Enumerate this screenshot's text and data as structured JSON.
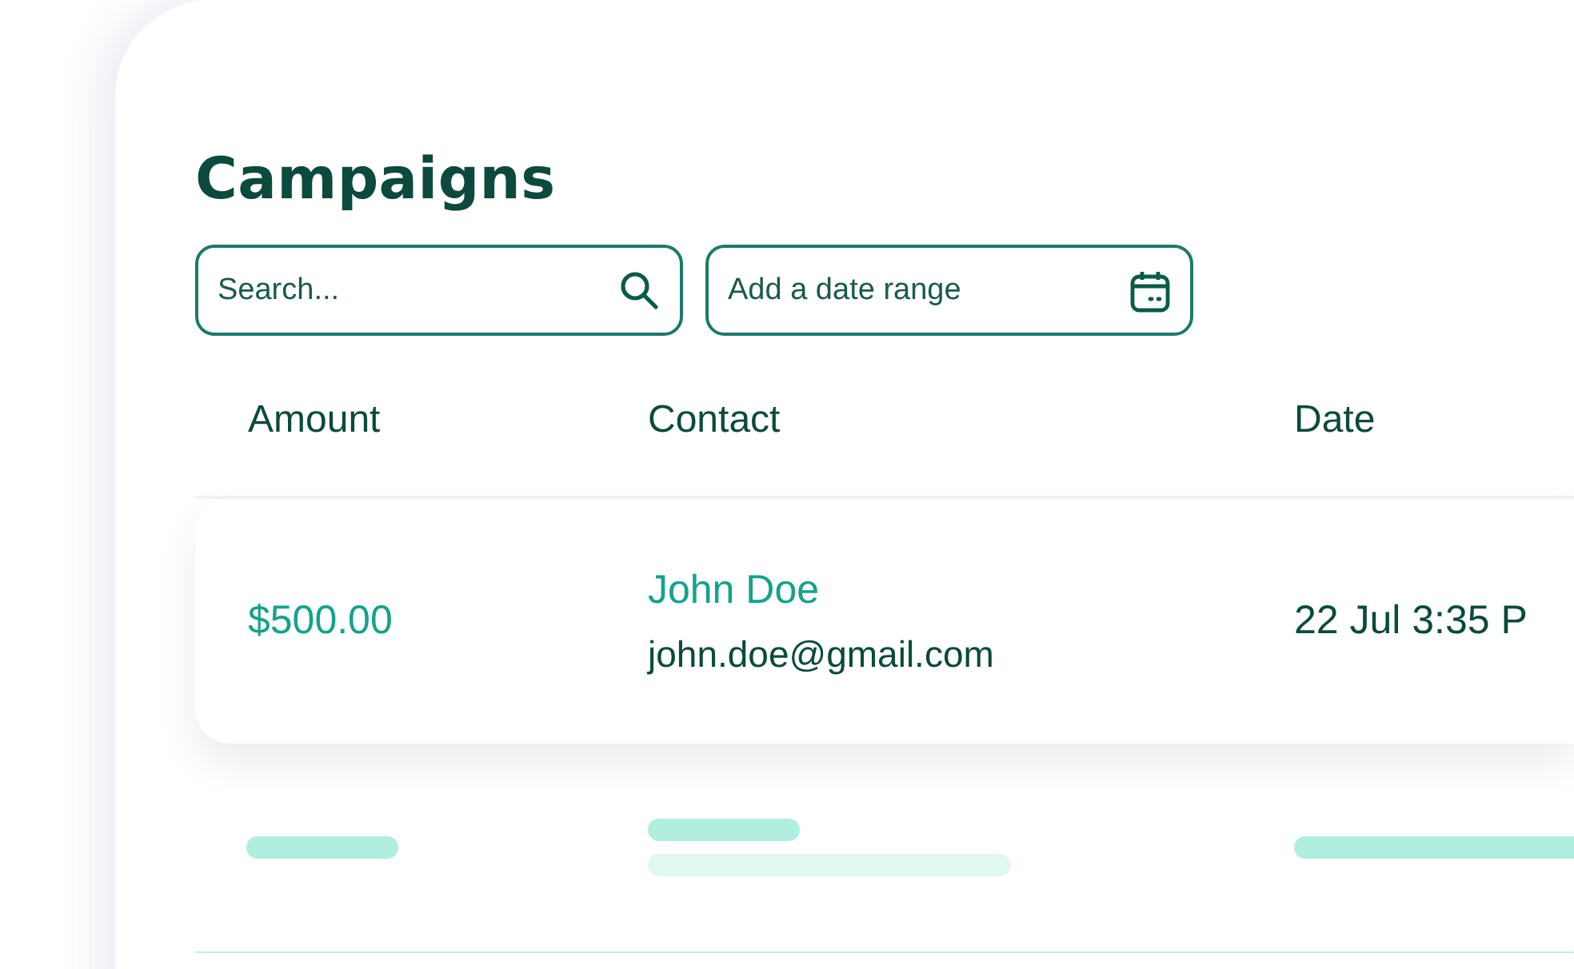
{
  "title": "Campaigns",
  "search": {
    "placeholder": "Search..."
  },
  "date_range": {
    "placeholder": "Add a date range"
  },
  "table": {
    "columns": [
      "Amount",
      "Contact",
      "Date"
    ],
    "rows": [
      {
        "amount": "$500.00",
        "contact_name": "John Doe",
        "contact_email": "john.doe@gmail.com",
        "date": "22 Jul 3:35 P"
      }
    ]
  }
}
